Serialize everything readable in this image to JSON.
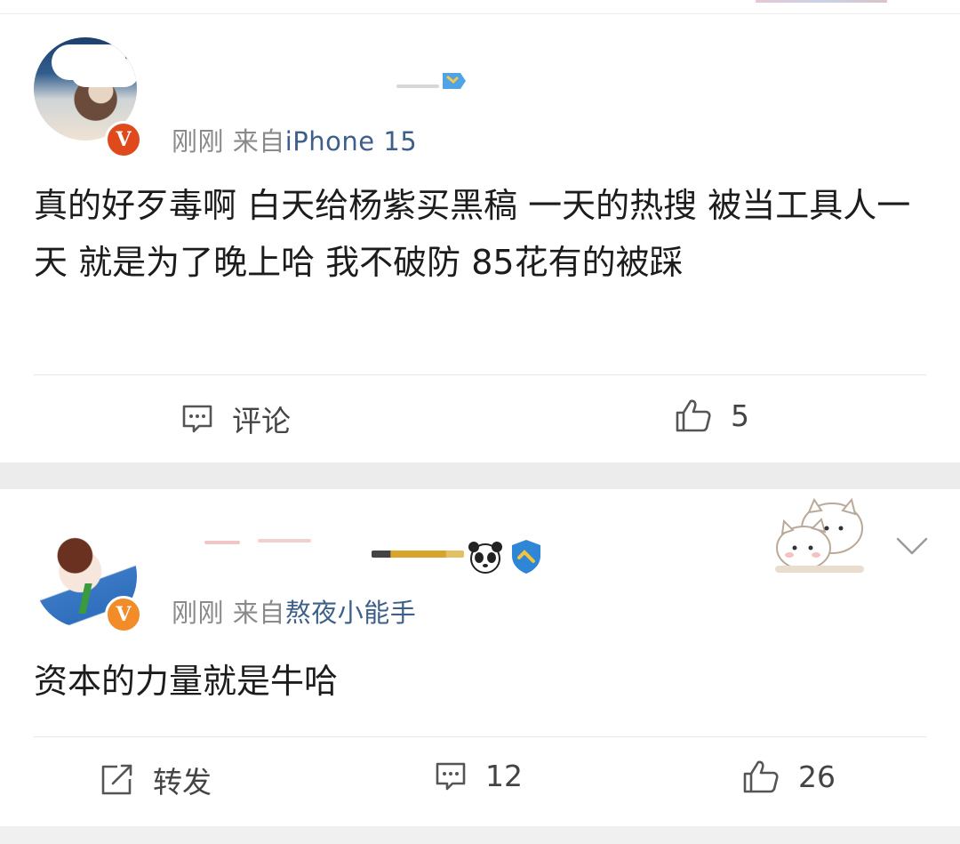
{
  "posts": [
    {
      "meta_time": "刚刚",
      "meta_from": "来自",
      "meta_source": "iPhone 15",
      "text": "真的好歹毒啊 白天给杨紫买黑稿 一天的热搜 被当工具人一天 就是为了晚上哈 我不破防 85花有的被踩",
      "actions": {
        "comment_label": "评论",
        "like_count": "5"
      },
      "badge": "V",
      "badge_color": "#e0491b"
    },
    {
      "meta_time": "刚刚",
      "meta_from": "来自",
      "meta_source": "熬夜小能手",
      "text": "资本的力量就是牛哈",
      "actions": {
        "repost_label": "转发",
        "comment_count": "12",
        "like_count": "26"
      },
      "badge": "V",
      "badge_color": "#f28c28"
    }
  ],
  "icons": {
    "comment": "comment-icon",
    "like": "thumbs-up-icon",
    "repost": "repost-icon",
    "more": "chevron-down-icon",
    "verified": "shield-icon",
    "panda": "panda-icon",
    "sticker": "cat-sticker"
  },
  "colors": {
    "source_link": "#3d5f8a",
    "meta_gray": "#8a8a8a",
    "separator": "#ececec"
  }
}
